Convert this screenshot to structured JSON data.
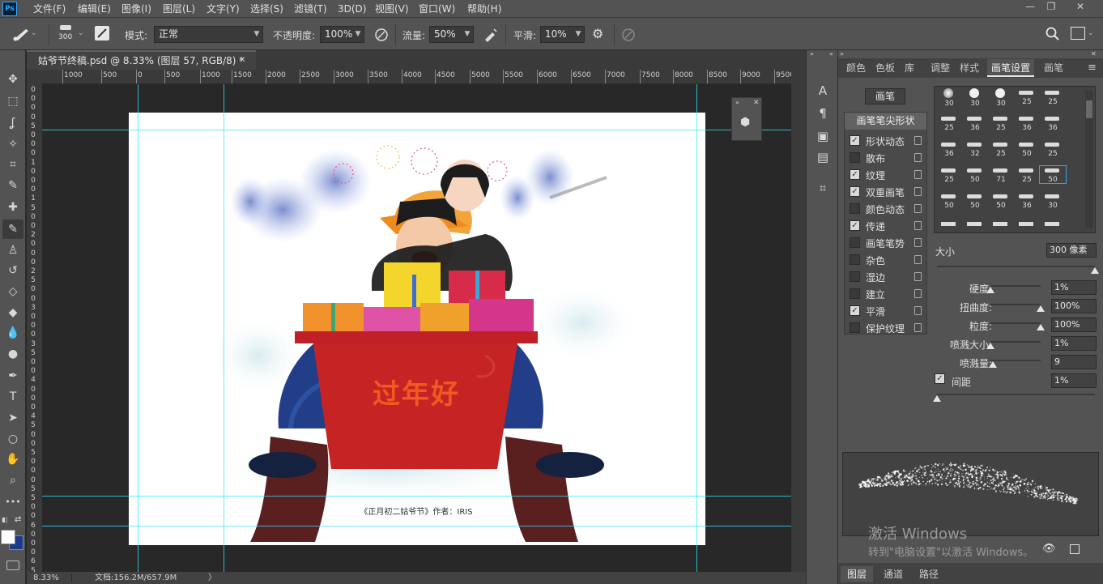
{
  "app": {
    "logo": "Ps"
  },
  "menu": [
    "文件(F)",
    "编辑(E)",
    "图像(I)",
    "图层(L)",
    "文字(Y)",
    "选择(S)",
    "滤镜(T)",
    "3D(D)",
    "视图(V)",
    "窗口(W)",
    "帮助(H)"
  ],
  "window_controls": {
    "minimize": "—",
    "restore": "❐",
    "close": "✕"
  },
  "options": {
    "brush_size": "300",
    "mode_label": "模式:",
    "mode_value": "正常",
    "opacity_label": "不透明度:",
    "opacity_value": "100%",
    "flow_label": "流量:",
    "flow_value": "50%",
    "smoothing_label": "平滑:",
    "smoothing_value": "10%"
  },
  "document": {
    "tab_title": "姑爷节终稿.psd @ 8.33% (图层 57, RGB/8) *",
    "tab_close": "✕",
    "zoom": "8.33%",
    "doc_info": "文档:156.2M/657.9M",
    "status_arrow": "〉",
    "caption": "《正月初二姑爷节》作者：IRIS",
    "box_text": "过年好"
  },
  "ruler": {
    "top": [
      "1000",
      "500",
      "0",
      "500",
      "1000",
      "1500",
      "2000",
      "2500",
      "3000",
      "3500",
      "4000",
      "4500",
      "5000",
      "5500",
      "6000",
      "6500",
      "7000",
      "7500",
      "8000",
      "8500",
      "9000",
      "9500"
    ],
    "left": [
      "0",
      "0",
      "0",
      "0",
      "5",
      "0",
      "0",
      "0",
      "1",
      "0",
      "0",
      "0",
      "1",
      "5",
      "0",
      "0",
      "2",
      "0",
      "0",
      "0",
      "2",
      "5",
      "0",
      "0",
      "3",
      "0",
      "0",
      "0",
      "3",
      "5",
      "0",
      "0",
      "4",
      "0",
      "0",
      "0",
      "4",
      "5",
      "0",
      "0",
      "5",
      "0",
      "0",
      "0",
      "5",
      "5",
      "0",
      "0",
      "6",
      "0",
      "0",
      "0",
      "6",
      "5"
    ]
  },
  "tools": [
    {
      "name": "move-tool",
      "glyph": "✥"
    },
    {
      "name": "marquee-tool",
      "glyph": "⬚"
    },
    {
      "name": "lasso-tool",
      "glyph": "ʆ"
    },
    {
      "name": "magic-wand-tool",
      "glyph": "✧"
    },
    {
      "name": "crop-tool",
      "glyph": "⌗"
    },
    {
      "name": "eyedropper-tool",
      "glyph": "✎"
    },
    {
      "name": "healing-tool",
      "glyph": "✚"
    },
    {
      "name": "brush-tool",
      "glyph": "✎"
    },
    {
      "name": "stamp-tool",
      "glyph": "♙"
    },
    {
      "name": "history-brush-tool",
      "glyph": "↺"
    },
    {
      "name": "eraser-tool",
      "glyph": "◇"
    },
    {
      "name": "paint-bucket-tool",
      "glyph": "◆"
    },
    {
      "name": "blur-tool",
      "glyph": "💧"
    },
    {
      "name": "dodge-tool",
      "glyph": "●"
    },
    {
      "name": "pen-tool",
      "glyph": "✒"
    },
    {
      "name": "type-tool",
      "glyph": "T"
    },
    {
      "name": "path-select-tool",
      "glyph": "➤"
    },
    {
      "name": "ellipse-tool",
      "glyph": "○"
    },
    {
      "name": "hand-tool",
      "glyph": "✋"
    },
    {
      "name": "zoom-tool",
      "glyph": "⌕"
    },
    {
      "name": "more-tools",
      "glyph": "•••"
    }
  ],
  "panel_tabs": [
    "颜色",
    "色板",
    "库",
    "调整",
    "样式",
    "画笔设置",
    "画笔"
  ],
  "active_panel_tab": "画笔设置",
  "brush_settings": {
    "preset_button": "画笔",
    "tip_shape": "画笔笔尖形状",
    "options": [
      {
        "label": "形状动态",
        "checked": true
      },
      {
        "label": "散布",
        "checked": false
      },
      {
        "label": "纹理",
        "checked": true
      },
      {
        "label": "双重画笔",
        "checked": true
      },
      {
        "label": "颜色动态",
        "checked": false
      },
      {
        "label": "传递",
        "checked": true
      },
      {
        "label": "画笔笔势",
        "checked": false
      },
      {
        "label": "杂色",
        "checked": false
      },
      {
        "label": "湿边",
        "checked": false
      },
      {
        "label": "建立",
        "checked": false
      },
      {
        "label": "平滑",
        "checked": true
      },
      {
        "label": "保护纹理",
        "checked": false
      }
    ],
    "preset_sizes": [
      "30",
      "30",
      "30",
      "25",
      "25",
      "25",
      "36",
      "25",
      "36",
      "36",
      "36",
      "32",
      "25",
      "50",
      "25",
      "25",
      "50",
      "71",
      "25",
      "50",
      "50",
      "50",
      "50",
      "36",
      "30"
    ],
    "size_label": "大小",
    "size_value": "300 像素",
    "hardness_label": "硬度:",
    "hardness_value": "1%",
    "hardness_level": 0.0,
    "distortion_label": "扭曲度:",
    "distortion_value": "100%",
    "distortion_level": 1.0,
    "grain_label": "粒度:",
    "grain_value": "100%",
    "grain_level": 1.0,
    "spray_size_label": "喷溅大小:",
    "spray_size_value": "1%",
    "spray_size_level": 0.0,
    "spray_amount_label": "喷溅量:",
    "spray_amount_value": "9",
    "spray_amount_level": 0.05,
    "spacing_label": "间距",
    "spacing_value": "1%",
    "spacing_checked": true
  },
  "bottom_tabs": [
    "图层",
    "通道",
    "路径"
  ],
  "watermark": {
    "line1": "激活 Windows",
    "line2": "转到\"电脑设置\"以激活 Windows。"
  },
  "colors": {
    "accent": "#36e6ff",
    "foreground": "#ffffff",
    "background": "#1a3a8c"
  }
}
